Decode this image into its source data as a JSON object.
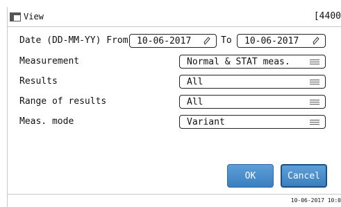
{
  "window": {
    "title": "View",
    "screen_code": "[4400"
  },
  "date": {
    "label": "Date (DD-MM-YY) From",
    "from": "10-06-2017",
    "to_label": "To",
    "to": "10-06-2017"
  },
  "measurement": {
    "label": "Measurement",
    "value": "Normal & STAT meas."
  },
  "results": {
    "label": "Results",
    "value": "All"
  },
  "range": {
    "label": "Range of results",
    "value": "All"
  },
  "meas_mode": {
    "label": "Meas. mode",
    "value": "Variant"
  },
  "buttons": {
    "ok": "OK",
    "cancel": "Cancel"
  },
  "status": {
    "timestamp": "10-06-2017 10:0"
  }
}
